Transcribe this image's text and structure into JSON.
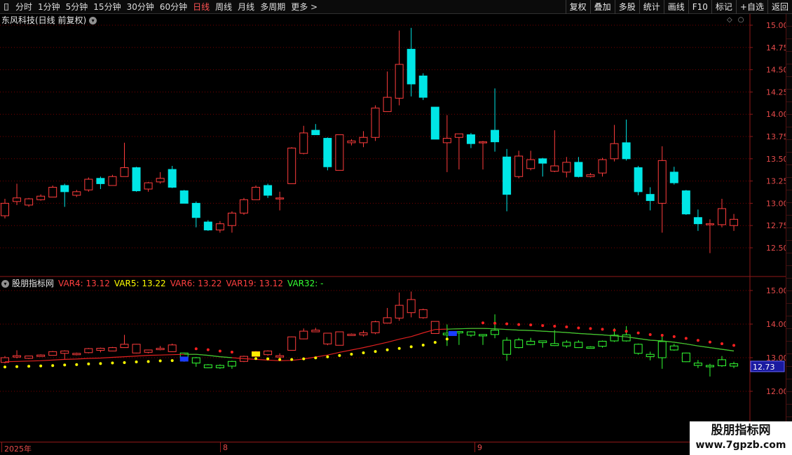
{
  "toolbar": {
    "periods": [
      {
        "label": "分时",
        "active": false
      },
      {
        "label": "1分钟",
        "active": false
      },
      {
        "label": "5分钟",
        "active": false
      },
      {
        "label": "15分钟",
        "active": false
      },
      {
        "label": "30分钟",
        "active": false
      },
      {
        "label": "60分钟",
        "active": false
      },
      {
        "label": "日线",
        "active": true
      },
      {
        "label": "周线",
        "active": false
      },
      {
        "label": "月线",
        "active": false
      },
      {
        "label": "多周期",
        "active": false
      },
      {
        "label": "更多 >",
        "active": false
      }
    ],
    "tools": [
      "复权",
      "叠加",
      "多股",
      "统计",
      "画线",
      "F10",
      "标记",
      "+自选",
      "返回"
    ]
  },
  "main_panel": {
    "title": "东风科技(日线 前复权)",
    "icons": [
      "diamond-icon",
      "circle-icon"
    ]
  },
  "sub_panel": {
    "name": "股朋指标网",
    "legend": [
      {
        "label": "VAR4: 13.12",
        "color": "#ff4040"
      },
      {
        "label": "VAR5: 13.22",
        "color": "#ffff00"
      },
      {
        "label": "VAR6: 13.22",
        "color": "#ff4040"
      },
      {
        "label": "VAR19: 13.12",
        "color": "#ff4040"
      },
      {
        "label": "VAR32: -",
        "color": "#33ff33"
      }
    ],
    "last_price": "12.73"
  },
  "time_axis": [
    "2025年",
    "8",
    "9"
  ],
  "watermark": {
    "title": "股朋指标网",
    "url": "www.7gpzb.com"
  },
  "colors": {
    "up": "#ff3c3c",
    "down": "#00e6e6",
    "sub_up": "#ff3c3c",
    "sub_down": "#33ff33",
    "axis": "#e84b4b",
    "grid": "#7a0000"
  },
  "chart_data": {
    "type": "candlestick",
    "main_y_ticks": [
      "15.00",
      "14.75",
      "14.50",
      "14.25",
      "14.00",
      "13.75",
      "13.50",
      "13.25",
      "13.00",
      "12.75",
      "12.50"
    ],
    "sub_y_ticks": [
      "15.00",
      "14.00",
      "13.00",
      "12.00"
    ],
    "candles": [
      [
        12.86,
        13.0,
        13.05,
        12.83
      ],
      [
        13.02,
        13.06,
        13.22,
        12.98
      ],
      [
        12.98,
        13.05,
        13.06,
        12.96
      ],
      [
        13.04,
        13.08,
        13.1,
        13.03
      ],
      [
        13.07,
        13.18,
        13.2,
        13.07
      ],
      [
        13.2,
        13.13,
        13.22,
        12.96
      ],
      [
        13.09,
        13.13,
        13.15,
        13.07
      ],
      [
        13.15,
        13.27,
        13.29,
        13.13
      ],
      [
        13.28,
        13.22,
        13.3,
        13.16
      ],
      [
        13.2,
        13.3,
        13.32,
        13.2
      ],
      [
        13.3,
        13.4,
        13.68,
        13.3
      ],
      [
        13.4,
        13.14,
        13.41,
        13.13
      ],
      [
        13.16,
        13.23,
        13.24,
        13.13
      ],
      [
        13.24,
        13.28,
        13.35,
        13.22
      ],
      [
        13.38,
        13.18,
        13.42,
        13.17
      ],
      [
        13.14,
        13.0,
        13.15,
        13.0
      ],
      [
        13.0,
        12.84,
        13.02,
        12.73
      ],
      [
        12.79,
        12.7,
        12.81,
        12.69
      ],
      [
        12.7,
        12.77,
        12.8,
        12.67
      ],
      [
        12.75,
        12.89,
        12.91,
        12.67
      ],
      [
        12.89,
        13.04,
        13.06,
        12.87
      ],
      [
        13.04,
        13.18,
        13.2,
        13.04
      ],
      [
        13.2,
        13.09,
        13.22,
        13.06
      ],
      [
        13.05,
        13.06,
        13.13,
        12.92
      ],
      [
        13.22,
        13.62,
        13.63,
        13.22
      ],
      [
        13.56,
        13.79,
        13.87,
        13.55
      ],
      [
        13.82,
        13.77,
        13.89,
        13.77
      ],
      [
        13.73,
        13.41,
        13.74,
        13.37
      ],
      [
        13.37,
        13.77,
        13.77,
        13.37
      ],
      [
        13.68,
        13.7,
        13.72,
        13.65
      ],
      [
        13.68,
        13.74,
        13.81,
        13.63
      ],
      [
        13.74,
        14.07,
        14.1,
        13.7
      ],
      [
        14.03,
        14.19,
        14.48,
        14.1
      ],
      [
        14.18,
        14.56,
        14.94,
        14.1
      ],
      [
        14.73,
        14.34,
        14.97,
        14.2
      ],
      [
        14.43,
        14.19,
        14.46,
        14.16
      ],
      [
        14.08,
        13.72,
        14.08,
        13.72
      ],
      [
        13.68,
        13.73,
        13.99,
        13.35
      ],
      [
        13.74,
        13.78,
        13.78,
        13.38
      ],
      [
        13.77,
        13.67,
        13.79,
        13.62
      ],
      [
        13.68,
        13.69,
        13.7,
        13.38
      ],
      [
        13.82,
        13.69,
        14.29,
        13.58
      ],
      [
        13.52,
        13.1,
        13.61,
        12.91
      ],
      [
        13.3,
        13.53,
        13.59,
        13.28
      ],
      [
        13.39,
        13.49,
        13.59,
        13.37
      ],
      [
        13.5,
        13.45,
        13.51,
        13.3
      ],
      [
        13.36,
        13.42,
        13.82,
        13.35
      ],
      [
        13.35,
        13.46,
        13.52,
        13.29
      ],
      [
        13.46,
        13.3,
        13.52,
        13.29
      ],
      [
        13.3,
        13.32,
        13.34,
        13.29
      ],
      [
        13.34,
        13.49,
        13.51,
        13.3
      ],
      [
        13.5,
        13.67,
        13.88,
        13.47
      ],
      [
        13.68,
        13.5,
        13.94,
        13.48
      ],
      [
        13.4,
        13.13,
        13.42,
        13.09
      ],
      [
        13.1,
        13.03,
        13.18,
        12.92
      ],
      [
        13.0,
        13.48,
        13.64,
        12.67
      ],
      [
        13.35,
        13.23,
        13.41,
        13.21
      ],
      [
        13.14,
        12.88,
        13.15,
        12.87
      ],
      [
        12.84,
        12.77,
        12.93,
        12.69
      ],
      [
        12.77,
        12.77,
        12.82,
        12.44
      ],
      [
        12.76,
        12.94,
        13.05,
        12.73
      ],
      [
        12.75,
        12.82,
        12.88,
        12.69
      ]
    ],
    "sub_candles_ranges": [
      [
        12.97,
        12.52
      ]
    ],
    "var_red_line": [
      12.88,
      12.89,
      12.9,
      12.91,
      12.93,
      12.95,
      12.96,
      12.98,
      12.99,
      13.01,
      13.03,
      13.05,
      13.07,
      13.08,
      13.09,
      13.1,
      13.1,
      13.07,
      13.03,
      13.0,
      12.97,
      12.95,
      12.93,
      12.91,
      12.92,
      12.96,
      13.02,
      13.08,
      13.16,
      13.23,
      13.3,
      13.38,
      13.46,
      13.55,
      13.63,
      13.74,
      13.84,
      13.85,
      13.86,
      13.87,
      13.87,
      13.86,
      13.84,
      13.82,
      13.81,
      13.79,
      13.77,
      13.75,
      13.72,
      13.7,
      13.68,
      13.65,
      13.62,
      13.57,
      13.52,
      13.5,
      13.46,
      13.41,
      13.35,
      13.3,
      13.25,
      13.2
    ],
    "var_yellow_dots": [
      12.85,
      12.86,
      12.87,
      12.88,
      12.89,
      12.91,
      12.92,
      12.94,
      12.95,
      12.97,
      12.98,
      13.0,
      13.01,
      13.03,
      13.04,
      13.05,
      null,
      null,
      null,
      null,
      null,
      13.1,
      13.09,
      13.07,
      13.07,
      13.09,
      13.12,
      13.15,
      13.19,
      13.23,
      13.27,
      13.31,
      13.36,
      13.4,
      13.45,
      13.5,
      13.58,
      13.68,
      null,
      null,
      null,
      null,
      null,
      null,
      null,
      null,
      null,
      null,
      null,
      null,
      null,
      null,
      null,
      null,
      null,
      null,
      null,
      null,
      null,
      null,
      null,
      null
    ]
  }
}
